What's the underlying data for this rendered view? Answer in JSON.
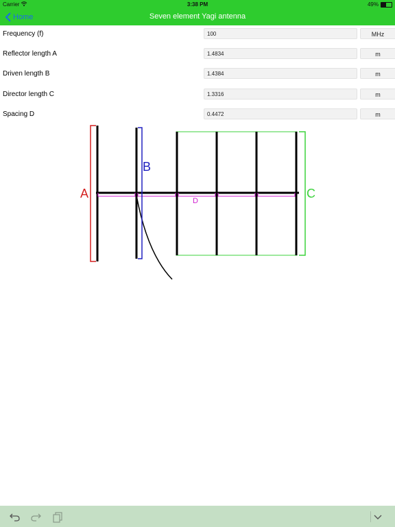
{
  "status_bar": {
    "carrier": "Carrier",
    "time": "3:38 PM",
    "battery_percent": "49%",
    "battery_level": 0.49
  },
  "nav": {
    "back_label": "Home",
    "title": "Seven element Yagi antenna"
  },
  "fields": {
    "frequency": {
      "label": "Frequency (f)",
      "value": "100",
      "unit": "MHz"
    },
    "reflector": {
      "label": "Reflector length A",
      "value": "1.4834",
      "unit": "m"
    },
    "driven": {
      "label": "Driven length B",
      "value": "1.4384",
      "unit": "m"
    },
    "director": {
      "label": "Director length C",
      "value": "1.3316",
      "unit": "m"
    },
    "spacing": {
      "label": "Spacing D",
      "value": "0.4472",
      "unit": "m"
    }
  },
  "diagram": {
    "label_a": "A",
    "label_b": "B",
    "label_c": "C",
    "label_d": "D",
    "colors": {
      "a": "#d42020",
      "b": "#2020c0",
      "c": "#3cd23c",
      "d": "#d020d0",
      "elements": "#000000"
    }
  },
  "toolbar": {
    "icons": [
      "undo-icon",
      "redo-icon",
      "copy-icon",
      "chevron-down-icon"
    ]
  }
}
